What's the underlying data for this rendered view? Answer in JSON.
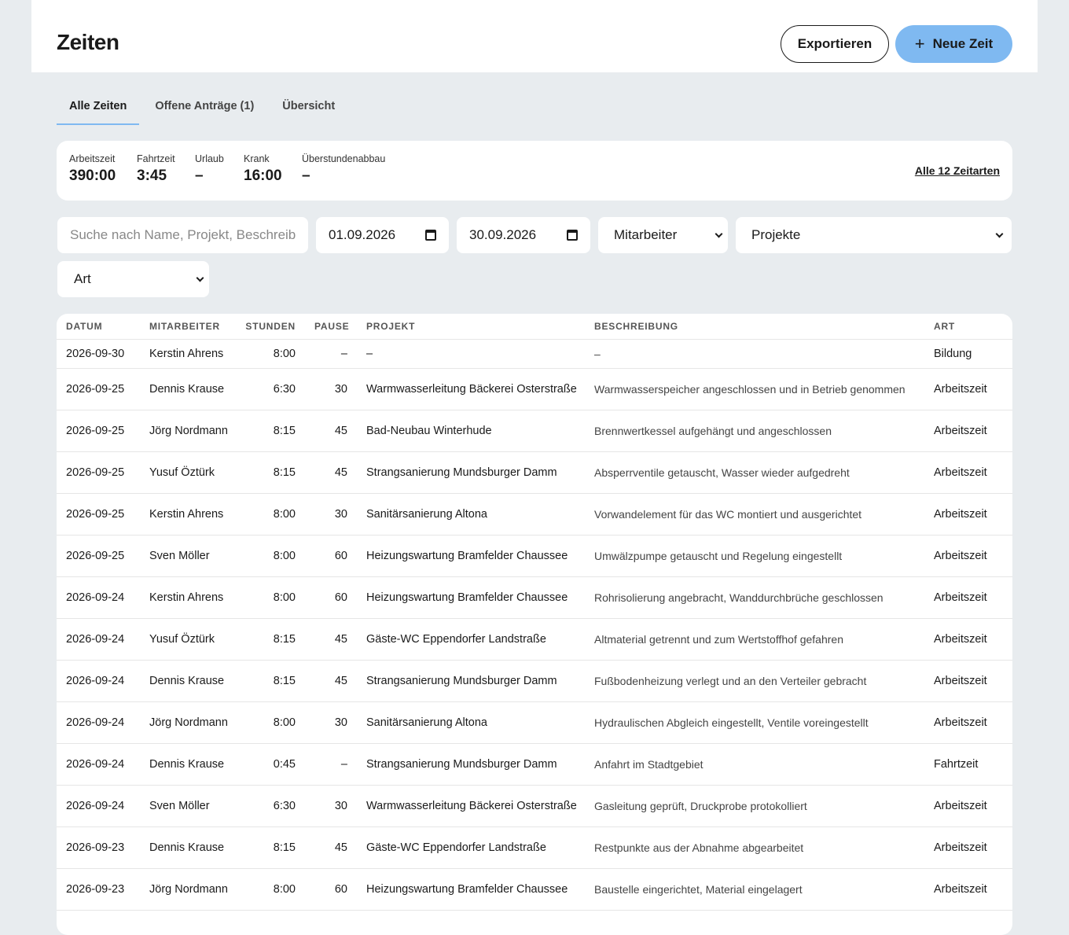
{
  "header": {
    "title": "Zeiten",
    "export_label": "Exportieren",
    "new_label": "Neue Zeit"
  },
  "tabs": [
    {
      "label": "Alle Zeiten",
      "active": true
    },
    {
      "label": "Offene Anträge (1)",
      "active": false
    },
    {
      "label": "Übersicht",
      "active": false
    }
  ],
  "summary": {
    "stats": [
      {
        "label": "Arbeitszeit",
        "value": "390:00"
      },
      {
        "label": "Fahrtzeit",
        "value": "3:45"
      },
      {
        "label": "Urlaub",
        "value": "–"
      },
      {
        "label": "Krank",
        "value": "16:00"
      },
      {
        "label": "Überstundenabbau",
        "value": "–"
      }
    ],
    "all_link": "Alle 12 Zeitarten"
  },
  "filters": {
    "search_placeholder": "Suche nach Name, Projekt, Beschreibung",
    "date_from": "01.09.2026",
    "date_to": "30.09.2026",
    "employee": "Mitarbeiter",
    "projects": "Projekte",
    "type": "Art"
  },
  "table": {
    "columns": [
      "DATUM",
      "MITARBEITER",
      "STUNDEN",
      "PAUSE",
      "PROJEKT",
      "BESCHREIBUNG",
      "ART"
    ],
    "rows": [
      [
        "2026-09-30",
        "Kerstin Ahrens",
        "8:00",
        "–",
        "–",
        "–",
        "Bildung"
      ],
      [
        "2026-09-25",
        "Dennis Krause",
        "6:30",
        "30",
        "Warmwasserleitung Bäckerei Osterstraße",
        "Warmwasserspeicher angeschlossen und in Betrieb genommen",
        "Arbeitszeit"
      ],
      [
        "2026-09-25",
        "Jörg Nordmann",
        "8:15",
        "45",
        "Bad-Neubau Winterhude",
        "Brennwertkessel aufgehängt und angeschlossen",
        "Arbeitszeit"
      ],
      [
        "2026-09-25",
        "Yusuf Öztürk",
        "8:15",
        "45",
        "Strangsanierung Mundsburger Damm",
        "Absperrventile getauscht, Wasser wieder aufgedreht",
        "Arbeitszeit"
      ],
      [
        "2026-09-25",
        "Kerstin Ahrens",
        "8:00",
        "30",
        "Sanitärsanierung Altona",
        "Vorwandelement für das WC montiert und ausgerichtet",
        "Arbeitszeit"
      ],
      [
        "2026-09-25",
        "Sven Möller",
        "8:00",
        "60",
        "Heizungswartung Bramfelder Chaussee",
        "Umwälzpumpe getauscht und Regelung eingestellt",
        "Arbeitszeit"
      ],
      [
        "2026-09-24",
        "Kerstin Ahrens",
        "8:00",
        "60",
        "Heizungswartung Bramfelder Chaussee",
        "Rohrisolierung angebracht, Wanddurchbrüche geschlossen",
        "Arbeitszeit"
      ],
      [
        "2026-09-24",
        "Yusuf Öztürk",
        "8:15",
        "45",
        "Gäste-WC Eppendorfer Landstraße",
        "Altmaterial getrennt und zum Wertstoffhof gefahren",
        "Arbeitszeit"
      ],
      [
        "2026-09-24",
        "Dennis Krause",
        "8:15",
        "45",
        "Strangsanierung Mundsburger Damm",
        "Fußbodenheizung verlegt und an den Verteiler gebracht",
        "Arbeitszeit"
      ],
      [
        "2026-09-24",
        "Jörg Nordmann",
        "8:00",
        "30",
        "Sanitärsanierung Altona",
        "Hydraulischen Abgleich eingestellt, Ventile voreingestellt",
        "Arbeitszeit"
      ],
      [
        "2026-09-24",
        "Dennis Krause",
        "0:45",
        "–",
        "Strangsanierung Mundsburger Damm",
        "Anfahrt im Stadtgebiet",
        "Fahrtzeit"
      ],
      [
        "2026-09-24",
        "Sven Möller",
        "6:30",
        "30",
        "Warmwasserleitung Bäckerei Osterstraße",
        "Gasleitung geprüft, Druckprobe protokolliert",
        "Arbeitszeit"
      ],
      [
        "2026-09-23",
        "Dennis Krause",
        "8:15",
        "45",
        "Gäste-WC Eppendorfer Landstraße",
        "Restpunkte aus der Abnahme abgearbeitet",
        "Arbeitszeit"
      ],
      [
        "2026-09-23",
        "Jörg Nordmann",
        "8:00",
        "60",
        "Heizungswartung Bramfelder Chaussee",
        "Baustelle eingerichtet, Material eingelagert",
        "Arbeitszeit"
      ]
    ]
  }
}
